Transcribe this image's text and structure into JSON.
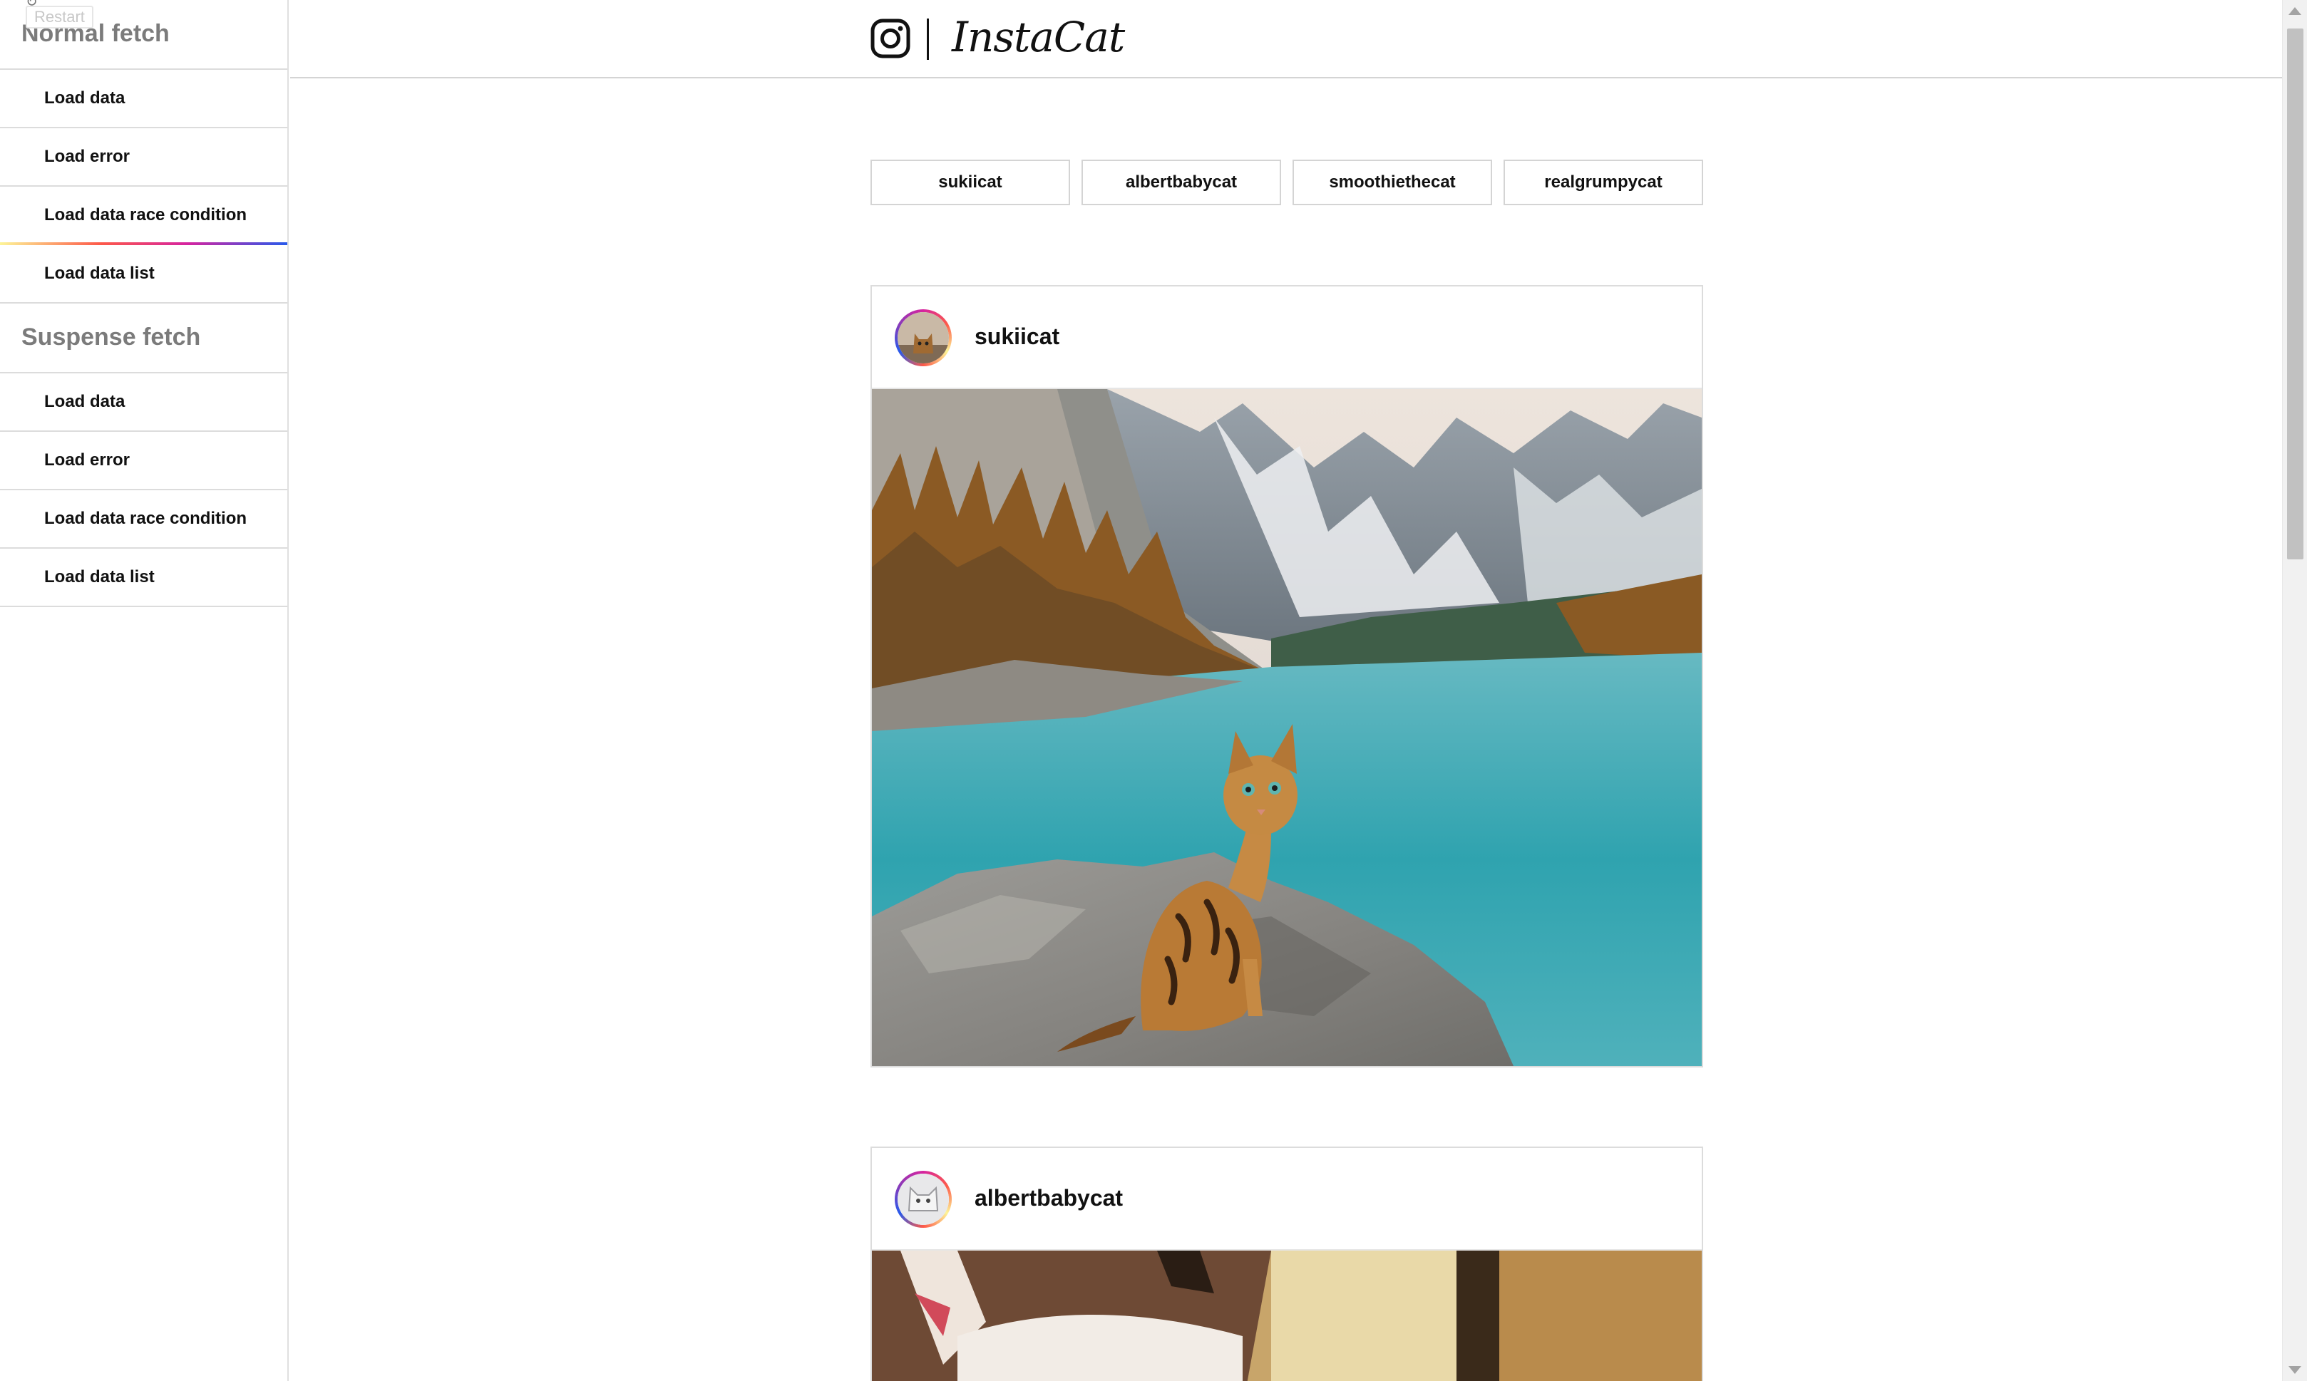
{
  "restart": {
    "label": "Restart"
  },
  "sidebar": {
    "sections": [
      {
        "title": "Normal fetch",
        "items": [
          "Load data",
          "Load error",
          "Load data race condition",
          "Load data list"
        ]
      },
      {
        "title": "Suspense fetch",
        "items": [
          "Load data",
          "Load error",
          "Load data race condition",
          "Load data list"
        ]
      }
    ],
    "active_item": "Normal fetch / Load data race condition"
  },
  "header": {
    "brand": "InstaCat"
  },
  "filters": [
    "sukiicat",
    "albertbabycat",
    "smoothiethecat",
    "realgrumpycat"
  ],
  "posts": [
    {
      "username": "sukiicat",
      "image": "bengal cat sitting on a rock by a turquoise mountain lake"
    },
    {
      "username": "albertbabycat",
      "image": "close-up of a fluffy cat face"
    }
  ],
  "colors": {
    "ig_gradient": [
      "#fdf497",
      "#fd5949",
      "#d6249f",
      "#285AEB"
    ],
    "border": "#dcdcdc",
    "section_title": "#7b7b7b"
  }
}
